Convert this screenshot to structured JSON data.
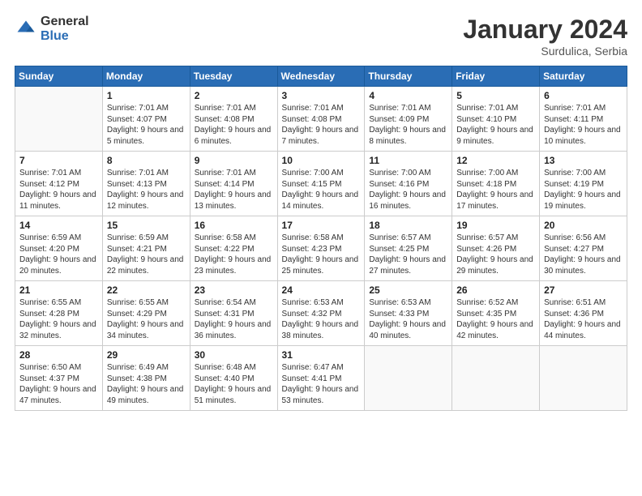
{
  "header": {
    "logo_general": "General",
    "logo_blue": "Blue",
    "month_year": "January 2024",
    "location": "Surdulica, Serbia"
  },
  "weekdays": [
    "Sunday",
    "Monday",
    "Tuesday",
    "Wednesday",
    "Thursday",
    "Friday",
    "Saturday"
  ],
  "weeks": [
    [
      {
        "day": "",
        "sunrise": "",
        "sunset": "",
        "daylight": ""
      },
      {
        "day": "1",
        "sunrise": "Sunrise: 7:01 AM",
        "sunset": "Sunset: 4:07 PM",
        "daylight": "Daylight: 9 hours and 5 minutes."
      },
      {
        "day": "2",
        "sunrise": "Sunrise: 7:01 AM",
        "sunset": "Sunset: 4:08 PM",
        "daylight": "Daylight: 9 hours and 6 minutes."
      },
      {
        "day": "3",
        "sunrise": "Sunrise: 7:01 AM",
        "sunset": "Sunset: 4:08 PM",
        "daylight": "Daylight: 9 hours and 7 minutes."
      },
      {
        "day": "4",
        "sunrise": "Sunrise: 7:01 AM",
        "sunset": "Sunset: 4:09 PM",
        "daylight": "Daylight: 9 hours and 8 minutes."
      },
      {
        "day": "5",
        "sunrise": "Sunrise: 7:01 AM",
        "sunset": "Sunset: 4:10 PM",
        "daylight": "Daylight: 9 hours and 9 minutes."
      },
      {
        "day": "6",
        "sunrise": "Sunrise: 7:01 AM",
        "sunset": "Sunset: 4:11 PM",
        "daylight": "Daylight: 9 hours and 10 minutes."
      }
    ],
    [
      {
        "day": "7",
        "sunrise": "Sunrise: 7:01 AM",
        "sunset": "Sunset: 4:12 PM",
        "daylight": "Daylight: 9 hours and 11 minutes."
      },
      {
        "day": "8",
        "sunrise": "Sunrise: 7:01 AM",
        "sunset": "Sunset: 4:13 PM",
        "daylight": "Daylight: 9 hours and 12 minutes."
      },
      {
        "day": "9",
        "sunrise": "Sunrise: 7:01 AM",
        "sunset": "Sunset: 4:14 PM",
        "daylight": "Daylight: 9 hours and 13 minutes."
      },
      {
        "day": "10",
        "sunrise": "Sunrise: 7:00 AM",
        "sunset": "Sunset: 4:15 PM",
        "daylight": "Daylight: 9 hours and 14 minutes."
      },
      {
        "day": "11",
        "sunrise": "Sunrise: 7:00 AM",
        "sunset": "Sunset: 4:16 PM",
        "daylight": "Daylight: 9 hours and 16 minutes."
      },
      {
        "day": "12",
        "sunrise": "Sunrise: 7:00 AM",
        "sunset": "Sunset: 4:18 PM",
        "daylight": "Daylight: 9 hours and 17 minutes."
      },
      {
        "day": "13",
        "sunrise": "Sunrise: 7:00 AM",
        "sunset": "Sunset: 4:19 PM",
        "daylight": "Daylight: 9 hours and 19 minutes."
      }
    ],
    [
      {
        "day": "14",
        "sunrise": "Sunrise: 6:59 AM",
        "sunset": "Sunset: 4:20 PM",
        "daylight": "Daylight: 9 hours and 20 minutes."
      },
      {
        "day": "15",
        "sunrise": "Sunrise: 6:59 AM",
        "sunset": "Sunset: 4:21 PM",
        "daylight": "Daylight: 9 hours and 22 minutes."
      },
      {
        "day": "16",
        "sunrise": "Sunrise: 6:58 AM",
        "sunset": "Sunset: 4:22 PM",
        "daylight": "Daylight: 9 hours and 23 minutes."
      },
      {
        "day": "17",
        "sunrise": "Sunrise: 6:58 AM",
        "sunset": "Sunset: 4:23 PM",
        "daylight": "Daylight: 9 hours and 25 minutes."
      },
      {
        "day": "18",
        "sunrise": "Sunrise: 6:57 AM",
        "sunset": "Sunset: 4:25 PM",
        "daylight": "Daylight: 9 hours and 27 minutes."
      },
      {
        "day": "19",
        "sunrise": "Sunrise: 6:57 AM",
        "sunset": "Sunset: 4:26 PM",
        "daylight": "Daylight: 9 hours and 29 minutes."
      },
      {
        "day": "20",
        "sunrise": "Sunrise: 6:56 AM",
        "sunset": "Sunset: 4:27 PM",
        "daylight": "Daylight: 9 hours and 30 minutes."
      }
    ],
    [
      {
        "day": "21",
        "sunrise": "Sunrise: 6:55 AM",
        "sunset": "Sunset: 4:28 PM",
        "daylight": "Daylight: 9 hours and 32 minutes."
      },
      {
        "day": "22",
        "sunrise": "Sunrise: 6:55 AM",
        "sunset": "Sunset: 4:29 PM",
        "daylight": "Daylight: 9 hours and 34 minutes."
      },
      {
        "day": "23",
        "sunrise": "Sunrise: 6:54 AM",
        "sunset": "Sunset: 4:31 PM",
        "daylight": "Daylight: 9 hours and 36 minutes."
      },
      {
        "day": "24",
        "sunrise": "Sunrise: 6:53 AM",
        "sunset": "Sunset: 4:32 PM",
        "daylight": "Daylight: 9 hours and 38 minutes."
      },
      {
        "day": "25",
        "sunrise": "Sunrise: 6:53 AM",
        "sunset": "Sunset: 4:33 PM",
        "daylight": "Daylight: 9 hours and 40 minutes."
      },
      {
        "day": "26",
        "sunrise": "Sunrise: 6:52 AM",
        "sunset": "Sunset: 4:35 PM",
        "daylight": "Daylight: 9 hours and 42 minutes."
      },
      {
        "day": "27",
        "sunrise": "Sunrise: 6:51 AM",
        "sunset": "Sunset: 4:36 PM",
        "daylight": "Daylight: 9 hours and 44 minutes."
      }
    ],
    [
      {
        "day": "28",
        "sunrise": "Sunrise: 6:50 AM",
        "sunset": "Sunset: 4:37 PM",
        "daylight": "Daylight: 9 hours and 47 minutes."
      },
      {
        "day": "29",
        "sunrise": "Sunrise: 6:49 AM",
        "sunset": "Sunset: 4:38 PM",
        "daylight": "Daylight: 9 hours and 49 minutes."
      },
      {
        "day": "30",
        "sunrise": "Sunrise: 6:48 AM",
        "sunset": "Sunset: 4:40 PM",
        "daylight": "Daylight: 9 hours and 51 minutes."
      },
      {
        "day": "31",
        "sunrise": "Sunrise: 6:47 AM",
        "sunset": "Sunset: 4:41 PM",
        "daylight": "Daylight: 9 hours and 53 minutes."
      },
      {
        "day": "",
        "sunrise": "",
        "sunset": "",
        "daylight": ""
      },
      {
        "day": "",
        "sunrise": "",
        "sunset": "",
        "daylight": ""
      },
      {
        "day": "",
        "sunrise": "",
        "sunset": "",
        "daylight": ""
      }
    ]
  ]
}
